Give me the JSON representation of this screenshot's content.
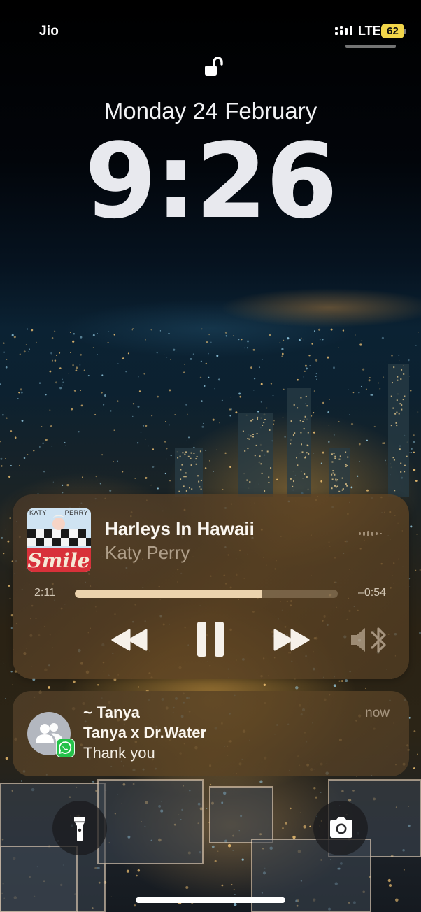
{
  "status_bar": {
    "carrier": "Jio",
    "network": "LTE",
    "battery_level": "62",
    "battery_color": "#f2d64a",
    "signal_icon": "cellular-signal-icon"
  },
  "lock_screen": {
    "lock_icon": "unlocked-padlock-icon",
    "date": "Monday 24 February",
    "time": "9:26"
  },
  "now_playing": {
    "album_art_icon": "album-art-smile",
    "album_text_left": "KATY",
    "album_text_right": "PERRY",
    "title": "Harleys In Hawaii",
    "artist": "Katy Perry",
    "elapsed": "2:11",
    "remaining": "–0:54",
    "progress": 0.71,
    "controls": {
      "rewind_icon": "rewind-icon",
      "pause_icon": "pause-icon",
      "forward_icon": "fast-forward-icon",
      "output_icon": "bluetooth-speaker-icon"
    }
  },
  "notification": {
    "app_icon": "whatsapp-icon",
    "avatar_icon": "group-avatar-icon",
    "sender": "~ Tanya",
    "group": "Tanya x Dr.Water",
    "message": "Thank you",
    "time": "now"
  },
  "quick_actions": {
    "flashlight_icon": "flashlight-icon",
    "camera_icon": "camera-icon"
  }
}
